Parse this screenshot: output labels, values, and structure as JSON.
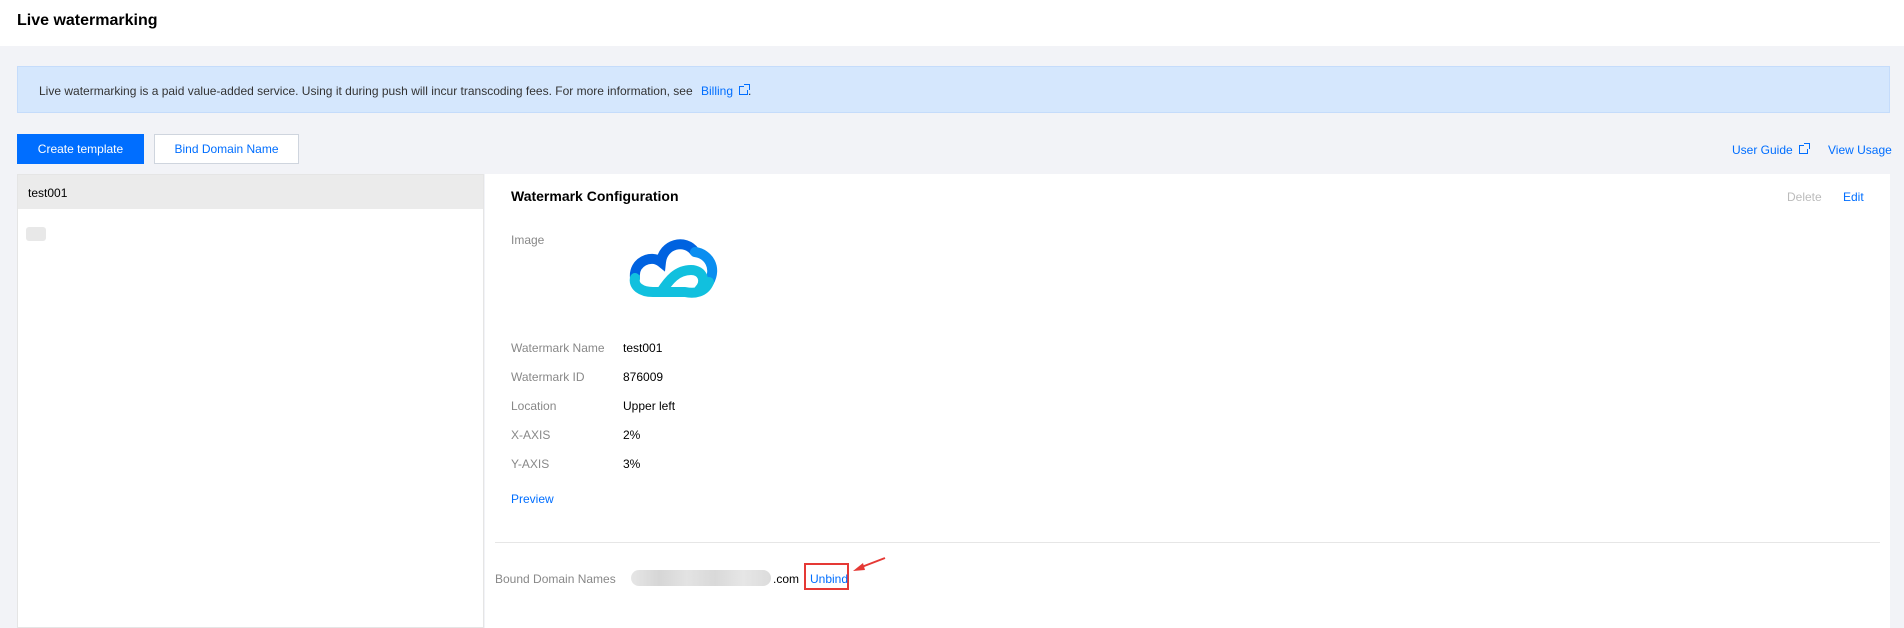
{
  "page": {
    "title": "Live watermarking"
  },
  "notice": {
    "text": "Live watermarking is a paid value-added service. Using it during push will incur transcoding fees. For more information, see",
    "link": "Billing",
    "suffix": "."
  },
  "toolbar": {
    "create_label": "Create template",
    "bind_label": "Bind Domain Name",
    "user_guide": "User Guide",
    "view_usage": "View Usage"
  },
  "templates": {
    "items": [
      {
        "label": "test001",
        "selected": true
      }
    ]
  },
  "config": {
    "title": "Watermark Configuration",
    "delete_label": "Delete",
    "edit_label": "Edit",
    "image_label": "Image",
    "image_icon": "cloud-logo-icon",
    "fields": {
      "name_label": "Watermark Name",
      "name_value": "test001",
      "id_label": "Watermark ID",
      "id_value": "876009",
      "location_label": "Location",
      "location_value": "Upper left",
      "x_label": "X-AXIS",
      "x_value": "2%",
      "y_label": "Y-AXIS",
      "y_value": "3%"
    },
    "preview_label": "Preview"
  },
  "bound": {
    "label": "Bound Domain Names",
    "domain_suffix": ".com",
    "unbind_label": "Unbind"
  },
  "colors": {
    "accent": "#006eff",
    "notice_bg": "#d5e7fd",
    "highlight": "#e53935",
    "logo_blue": "#0062e0",
    "logo_cyan": "#11c0de"
  }
}
